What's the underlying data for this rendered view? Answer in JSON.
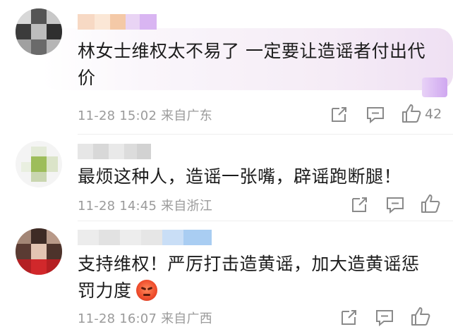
{
  "comments": [
    {
      "text": "林女士维权太不易了 一定要让造谣者付出代价",
      "text_line1": "林女士维权太不易了 一定要让造谣者付出代",
      "text_line2": "价",
      "date": "11-28 15:02",
      "location": "来自广东",
      "likes": "42",
      "highlighted": true
    },
    {
      "text": "最烦这种人，造谣一张嘴，辟谣跑断腿！",
      "date": "11-28 14:45",
      "location": "来自浙江",
      "likes": ""
    },
    {
      "text": "支持维权！严厉打击造黄谣，加大造黄谣惩罚力度",
      "text_line1": "支持维权！严厉打击造黄谣，加大造黄谣惩",
      "text_line2": "罚力度",
      "emoji": "angry-face-emoji",
      "date": "11-28 16:07",
      "location": "来自广西",
      "likes": ""
    }
  ],
  "icons": {
    "share": "share-icon",
    "comment": "comment-icon",
    "like": "thumbs-up-icon"
  },
  "colors": {
    "meta_text": "#9b9b9b",
    "highlight_bubble": "#f5ecf6",
    "icon_stroke": "#8a8a8a"
  }
}
